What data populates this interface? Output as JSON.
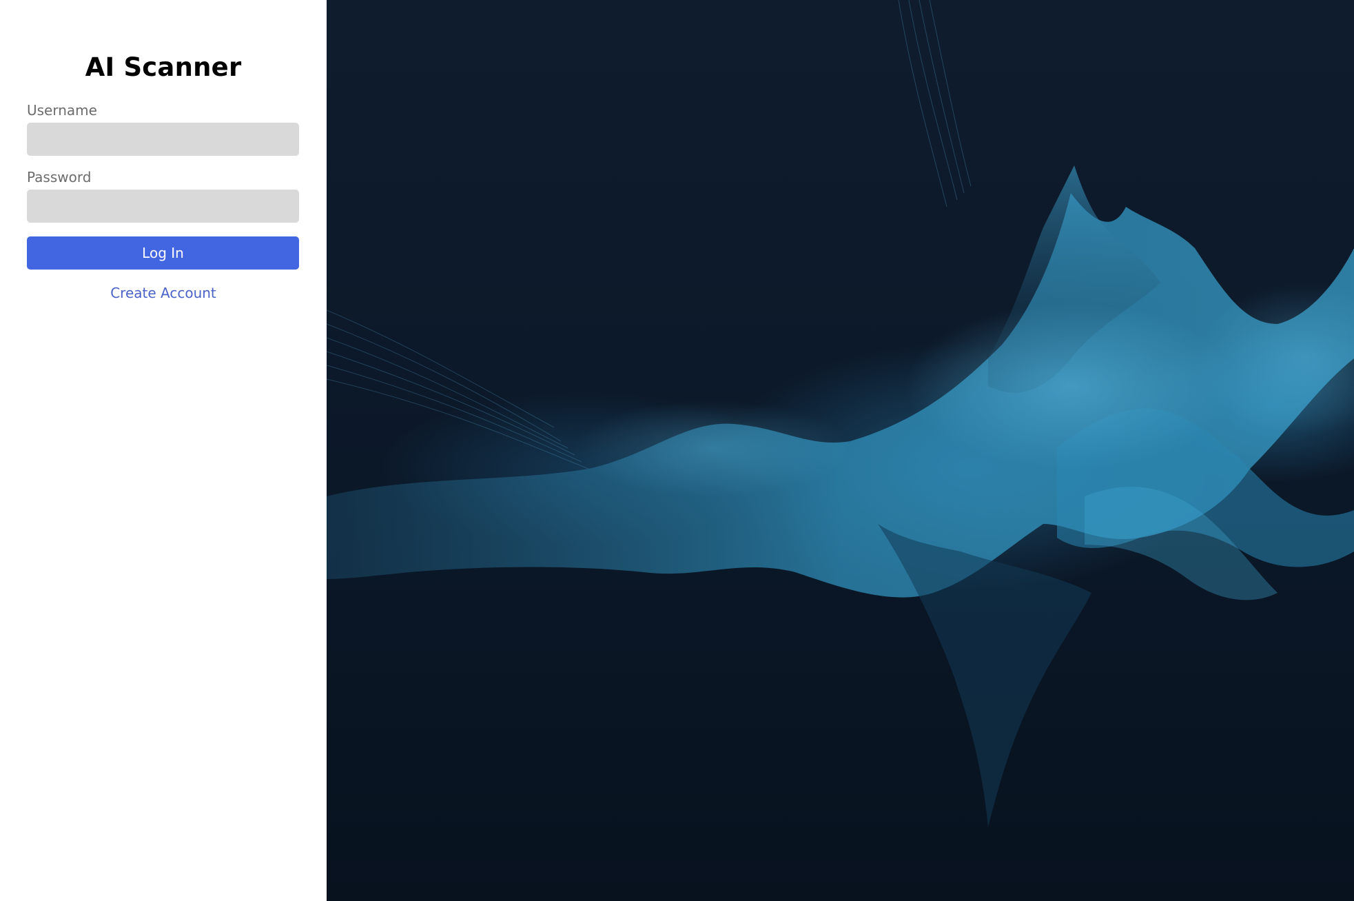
{
  "app": {
    "title": "AI Scanner"
  },
  "login_form": {
    "username_label": "Username",
    "username_value": "",
    "password_label": "Password",
    "password_value": "",
    "login_button_label": "Log In",
    "create_account_label": "Create Account"
  },
  "colors": {
    "primary_button": "#4265e2",
    "link": "#4b63c8",
    "input_background": "#d9d9d9",
    "art_background": "#0b1828"
  },
  "background_art": {
    "description_icon": "abstract-blue-fluid-art"
  }
}
